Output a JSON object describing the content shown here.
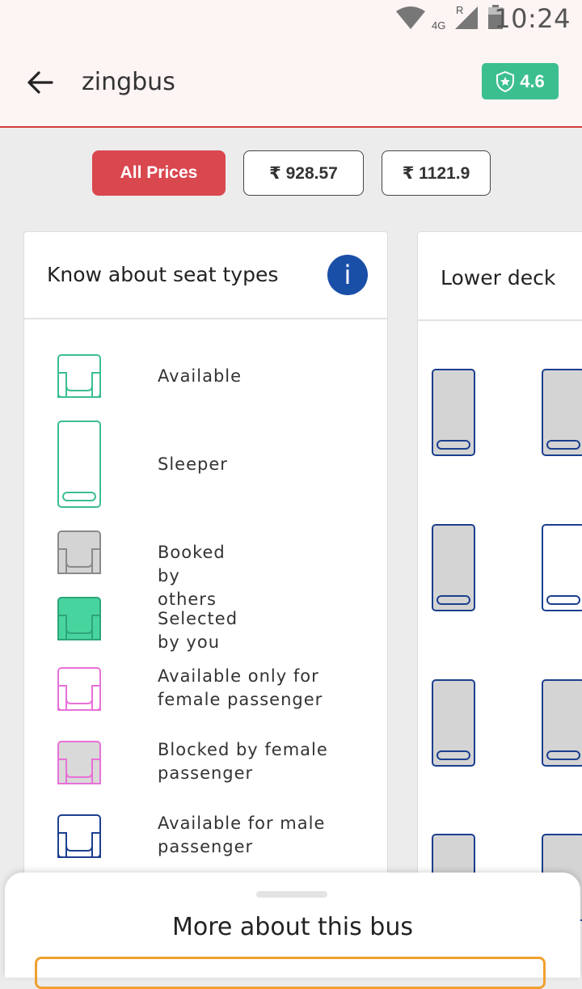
{
  "status_bar": {
    "time": "10:24",
    "network": "4G",
    "roaming": "R"
  },
  "app_bar": {
    "title": "zingbus",
    "rating": "4.6"
  },
  "price_filters": [
    "All Prices",
    "₹ 928.57",
    "₹ 1121.9"
  ],
  "legend": {
    "title": "Know about seat types",
    "items": [
      {
        "label": "Available"
      },
      {
        "label": "Sleeper"
      },
      {
        "label": "Booked by others"
      },
      {
        "label": "Selected by you"
      },
      {
        "label": "Available only for female passenger"
      },
      {
        "label": "Blocked by female passenger"
      },
      {
        "label": "Available for male passenger"
      }
    ]
  },
  "deck": {
    "title": "Lower deck"
  },
  "bottom_sheet": {
    "title": "More about this bus"
  },
  "colors": {
    "brand_red": "#d9474f",
    "rating_green": "#3cbf8f",
    "available_green": "#3cbf8f",
    "female_pink": "#e870d8",
    "male_blue": "#1c3f8f",
    "booked_gray": "#d4d4d4"
  }
}
